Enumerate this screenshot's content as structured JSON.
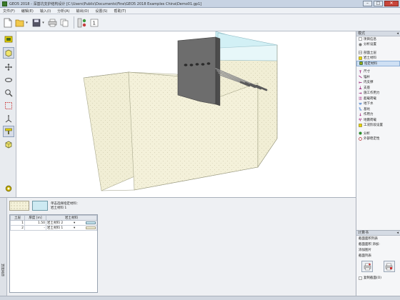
{
  "window": {
    "title": "GEO5 2018 - 深基坑支护结构设计 [C:\\Users\\Public\\Documents\\Fine\\GEO5 2018 Examples China\\Demo01.gp1]",
    "minimize": "–",
    "maximize": "□",
    "close": "✕"
  },
  "menu": [
    "文件(F)",
    "编辑(E)",
    "输入(I)",
    "分析(A)",
    "输出(O)",
    "设置(S)",
    "帮助(T)"
  ],
  "toolbar": {
    "new_icon": "new-file-icon",
    "open_icon": "open-folder-icon",
    "save_icon": "save-icon",
    "dropdown": "▾"
  },
  "stages_panel": {
    "header": "模式",
    "header_arrow": "◂",
    "items": [
      {
        "label": "项目信息",
        "icon": "info-icon",
        "selected": false
      },
      {
        "label": "分析设置",
        "icon": "gear-icon",
        "selected": false
      },
      {
        "label": "剖面土层",
        "icon": "layers-icon",
        "selected": false
      },
      {
        "label": "岩土材料",
        "icon": "material-icon",
        "selected": false
      },
      {
        "label": "指定材料",
        "icon": "assign-icon",
        "selected": true
      },
      {
        "label": "尺寸",
        "icon": "dimension-icon",
        "selected": false
      },
      {
        "label": "锚杆",
        "icon": "anchor-icon",
        "selected": false
      },
      {
        "label": "内支撑",
        "icon": "strut-icon",
        "selected": false
      },
      {
        "label": "支座",
        "icon": "support-icon",
        "selected": false
      },
      {
        "label": "施工作用力",
        "icon": "force-icon",
        "selected": false
      },
      {
        "label": "超载荷载",
        "icon": "surcharge-icon",
        "selected": false
      },
      {
        "label": "地下水",
        "icon": "water-icon",
        "selected": false
      },
      {
        "label": "基坑",
        "icon": "excavation-icon",
        "selected": false
      },
      {
        "label": "作用力",
        "icon": "load-icon",
        "selected": false
      },
      {
        "label": "地震荷载",
        "icon": "earthquake-icon",
        "selected": false
      },
      {
        "label": "工况阶段设置",
        "icon": "stage-icon",
        "selected": false
      },
      {
        "label": "分析",
        "icon": "analysis-icon",
        "selected": false
      },
      {
        "label": "外部稳定性",
        "icon": "stability-icon",
        "selected": false
      }
    ]
  },
  "calc_panel": {
    "header": "计算书",
    "rows": [
      "截面面积列表",
      "截面面积 添加:",
      "添加图片",
      "截面列表"
    ],
    "bottom_label": "复制截面(O)"
  },
  "bottom_panel": {
    "side_label": "指定材料",
    "swatch_text_line1": "单击选择指定材料：",
    "swatch_text_line2": "岩土材料 1",
    "table": {
      "headers": [
        "土层",
        "厚度 [m]",
        "岩土材料"
      ],
      "rows": [
        {
          "index": "1",
          "thickness": "1.50",
          "soil": "岩土材料 2",
          "chip": "blue"
        },
        {
          "index": "2",
          "thickness": "-",
          "soil": "岩土材料 1",
          "chip": "tan"
        }
      ]
    }
  },
  "colors": {
    "soil_fill": "#f3f0d8",
    "soil_edge": "#a7a78b",
    "top_layer": "#cdeef4",
    "wall": "#6a6a6a",
    "viewport_bg": "#ffffff"
  }
}
